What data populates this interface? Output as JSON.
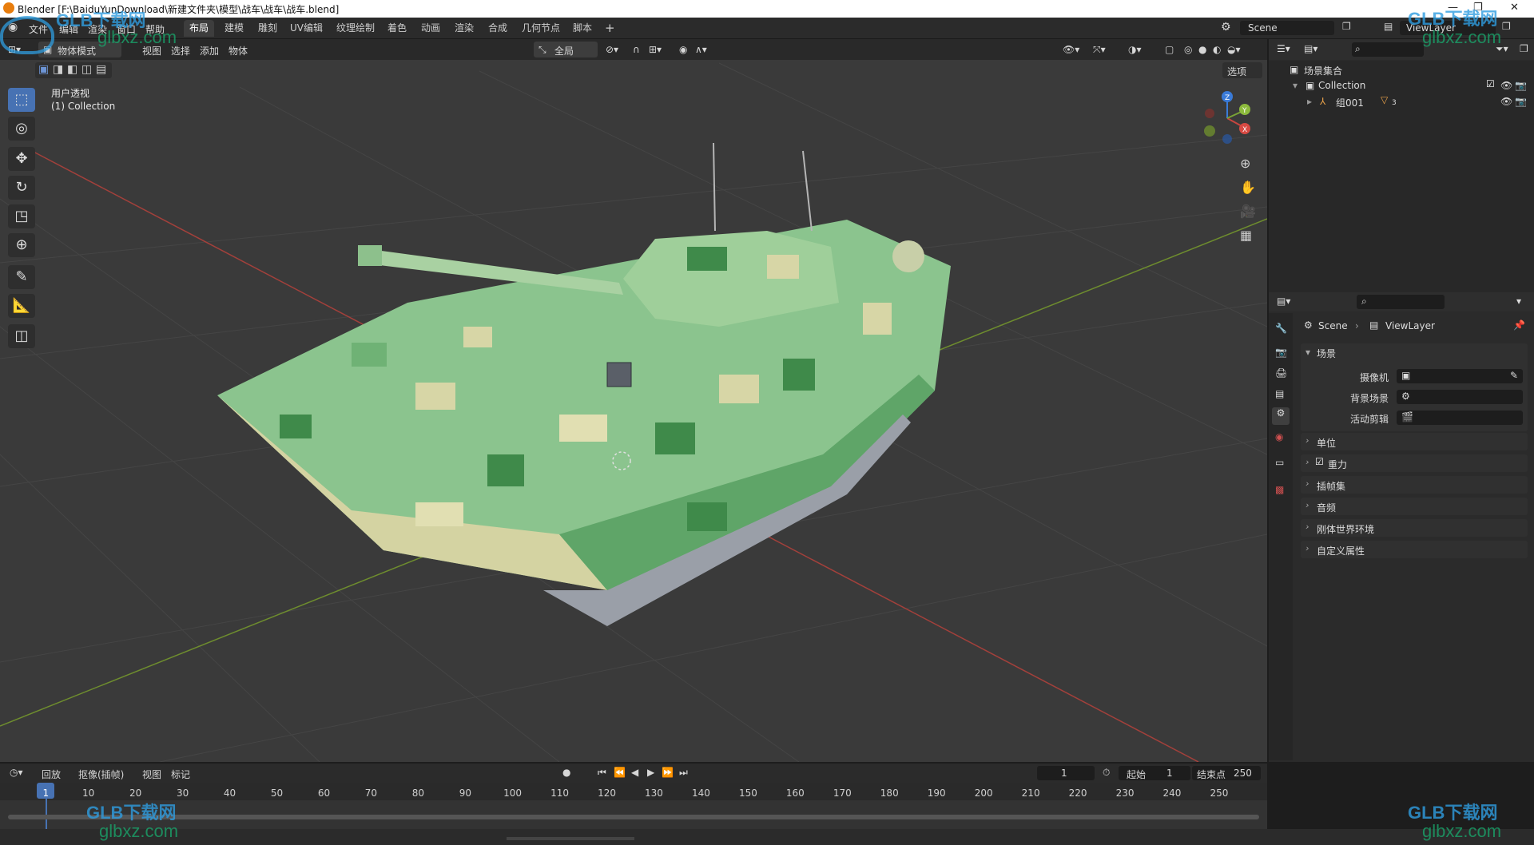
{
  "titlebar": {
    "title": "Blender [F:\\BaiduYunDownload\\新建文件夹\\模型\\战车\\战车\\战车.blend]"
  },
  "menu": [
    "文件",
    "编辑",
    "渲染",
    "窗口",
    "帮助"
  ],
  "workspaces": [
    "布局",
    "建模",
    "雕刻",
    "UV编辑",
    "纹理绘制",
    "着色",
    "动画",
    "渲染",
    "合成",
    "几何节点",
    "脚本"
  ],
  "active_workspace": "布局",
  "scene_name": "Scene",
  "viewlayer_name": "ViewLayer",
  "viewport": {
    "mode": "物体模式",
    "menus": [
      "视图",
      "选择",
      "添加",
      "物体"
    ],
    "orientation": "全局",
    "options": "选项",
    "view_name": "用户透视",
    "collection_label": "(1) Collection"
  },
  "outliner": {
    "root": "场景集合",
    "collection": "Collection",
    "object": "组001",
    "object_count": "3"
  },
  "properties": {
    "breadcrumb_scene": "Scene",
    "breadcrumb_layer": "ViewLayer",
    "section_scene": "场景",
    "camera_label": "摄像机",
    "background_label": "背景场景",
    "active_clip_label": "活动剪辑",
    "sections": [
      "单位",
      "重力",
      "插帧集",
      "音频",
      "刚体世界环境",
      "自定义属性"
    ]
  },
  "timeline": {
    "menus": [
      "回放",
      "抠像(插帧)",
      "视图",
      "标记"
    ],
    "current_frame": "1",
    "start_label": "起始",
    "start_value": "1",
    "end_label": "结束点",
    "end_value": "250",
    "ticks": [
      "1",
      "10",
      "20",
      "30",
      "40",
      "50",
      "60",
      "70",
      "80",
      "90",
      "100",
      "110",
      "120",
      "130",
      "140",
      "150",
      "160",
      "170",
      "180",
      "190",
      "200",
      "210",
      "220",
      "230",
      "240",
      "250"
    ]
  },
  "watermark": {
    "brand": "GLB下载网",
    "domain": "glbxz.com",
    "logo": "GLB"
  },
  "colors": {
    "accent": "#4772b3",
    "x_axis": "#c8463f",
    "y_axis": "#7aa336",
    "z_axis": "#3a7bd8",
    "camo_light": "#d7d6a6",
    "camo_mid": "#7fbf82",
    "camo_dark": "#3f8a4a"
  }
}
